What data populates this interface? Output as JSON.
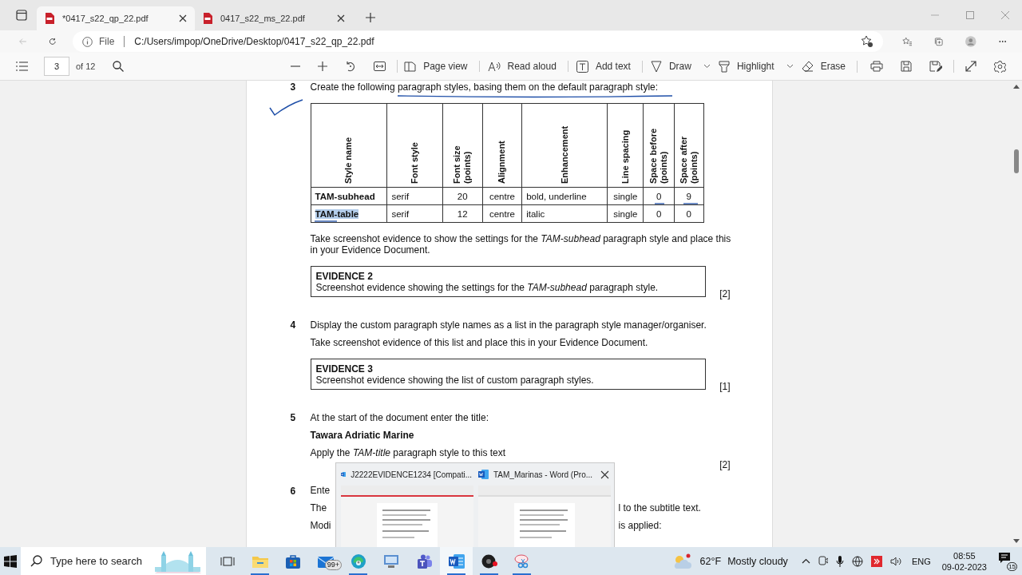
{
  "browser": {
    "tabs": [
      {
        "title": "*0417_s22_qp_22.pdf",
        "selected": true
      },
      {
        "title": "0417_s22_ms_22.pdf",
        "selected": false
      }
    ],
    "address": {
      "scheme": "File",
      "url": "C:/Users/impop/OneDrive/Desktop/0417_s22_qp_22.pdf"
    }
  },
  "pdf_toolbar": {
    "page": "3",
    "page_count": "of 12",
    "tools": [
      {
        "kind": "pageview",
        "label": "Page view",
        "dropdown": false,
        "divider_after": true
      },
      {
        "kind": "readaloud",
        "label": "Read aloud",
        "dropdown": false,
        "divider_after": true
      },
      {
        "kind": "addtext",
        "label": "Add text",
        "dropdown": false,
        "divider_after": true
      },
      {
        "kind": "draw",
        "label": "Draw",
        "dropdown": true,
        "divider_after": false
      },
      {
        "kind": "highlight",
        "label": "Highlight",
        "dropdown": true,
        "divider_after": false
      },
      {
        "kind": "erase",
        "label": "Erase",
        "dropdown": false,
        "divider_after": true
      }
    ]
  },
  "document": {
    "questions": [
      {
        "number": "3",
        "parts": [
          {
            "kind": "text",
            "text": "Create the following paragraph styles, basing them on the default paragraph style:"
          },
          {
            "kind": "table",
            "columns": [
              "Style name",
              "Font style",
              "Font size (points)",
              "Alignment",
              "Enhancement",
              "Line spacing",
              "Space before (points)",
              "Space after (points)"
            ],
            "rows": [
              {
                "cells": [
                  "TAM-subhead",
                  "serif",
                  "20",
                  "centre",
                  "bold, underline",
                  "single",
                  "0",
                  "9"
                ],
                "selected": false
              },
              {
                "cells": [
                  "TAM-table",
                  "serif",
                  "12",
                  "centre",
                  "italic",
                  "single",
                  "0",
                  "0"
                ],
                "selected": true
              }
            ]
          },
          {
            "kind": "text",
            "text": "Take screenshot evidence to show the settings for the *TAM-subhead* paragraph style and place this in your Evidence Document."
          },
          {
            "kind": "evidence",
            "title": "EVIDENCE 2",
            "text": "Screenshot evidence showing the settings for the *TAM-subhead* paragraph style.",
            "marks": "[2]"
          }
        ]
      },
      {
        "number": "4",
        "parts": [
          {
            "kind": "text",
            "text": "Display the custom paragraph style names as a list in the paragraph style manager/organiser."
          },
          {
            "kind": "text",
            "text": "Take screenshot evidence of this list and place this in your Evidence Document."
          },
          {
            "kind": "evidence",
            "title": "EVIDENCE 3",
            "text": "Screenshot evidence showing the list of custom paragraph styles.",
            "marks": "[1]"
          }
        ]
      },
      {
        "number": "5",
        "parts": [
          {
            "kind": "text",
            "text": "At the start of the document enter the title:"
          },
          {
            "kind": "heading",
            "text": "Tawara Adriatic Marine"
          },
          {
            "kind": "text",
            "text": "Apply the *TAM-title* paragraph style to this text"
          },
          {
            "kind": "marks",
            "text": "[2]"
          }
        ]
      },
      {
        "number": "6",
        "parts": [
          {
            "kind": "split",
            "left": "Ente"
          },
          {
            "kind": "split",
            "left": "The",
            "right": "l to the subtitle text."
          },
          {
            "kind": "split",
            "left": "Modi",
            "right": "is applied:"
          }
        ]
      }
    ]
  },
  "task_switcher": {
    "windows": [
      {
        "title": "J2222EVIDENCE1234 [Compati...",
        "closable": false
      },
      {
        "title": "TAM_Marinas - Word (Pro...",
        "closable": true
      }
    ]
  },
  "taskbar": {
    "search_placeholder": "Type here to search",
    "apps": [
      {
        "kind": "taskview",
        "running": false,
        "active": false
      },
      {
        "kind": "explorer",
        "running": true,
        "active": false
      },
      {
        "kind": "store",
        "running": false,
        "active": false
      },
      {
        "kind": "mail",
        "badge": "99+",
        "running": false,
        "active": false
      },
      {
        "kind": "edge",
        "running": true,
        "active": false
      },
      {
        "kind": "remote",
        "running": false,
        "active": false
      },
      {
        "kind": "teams",
        "running": false,
        "active": false
      },
      {
        "kind": "word",
        "running": true,
        "active": true
      },
      {
        "kind": "recorder",
        "running": true,
        "active": false
      },
      {
        "kind": "snip",
        "running": true,
        "active": false
      }
    ],
    "weather": {
      "temperature": "62°F",
      "condition": "Mostly cloudy"
    },
    "language": "ENG",
    "time": "08:55",
    "date": "09-02-2023",
    "notifications": "15"
  }
}
